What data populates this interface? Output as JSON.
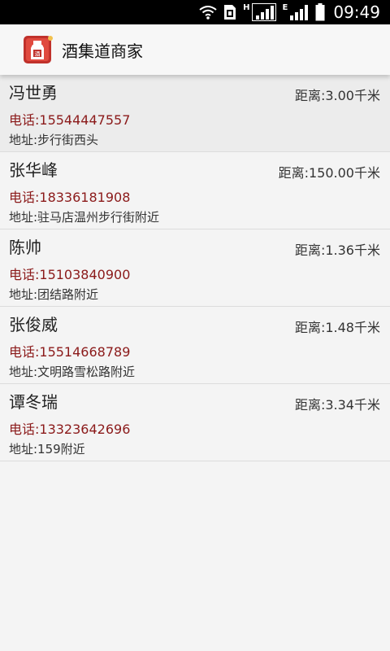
{
  "status_bar": {
    "network_h": "H",
    "network_e": "E",
    "time": "09:49",
    "icons": [
      "wifi-icon",
      "sim-icon",
      "signal-icon",
      "signal-icon",
      "battery-icon"
    ]
  },
  "app_bar": {
    "title": "酒集道商家",
    "logo_icon": "bottle-logo"
  },
  "merchants": [
    {
      "name": "冯世勇",
      "distance": "距离:3.00千米",
      "phone": "电话:15544447557",
      "address": "地址:步行街西头"
    },
    {
      "name": "张华峰",
      "distance": "距离:150.00千米",
      "phone": "电话:18336181908",
      "address": "地址:驻马店温州步行街附近"
    },
    {
      "name": "陈帅",
      "distance": "距离:1.36千米",
      "phone": "电话:15103840900",
      "address": "地址:团结路附近"
    },
    {
      "name": "张俊威",
      "distance": "距离:1.48千米",
      "phone": "电话:15514668789",
      "address": "地址:文明路雪松路附近"
    },
    {
      "name": "谭冬瑞",
      "distance": "距离:3.34千米",
      "phone": "电话:13323642696",
      "address": "地址:159附近"
    }
  ],
  "colors": {
    "phone_text": "#8b1a1a",
    "status_bar_bg": "#000000",
    "logo_red": "#c0312b"
  }
}
